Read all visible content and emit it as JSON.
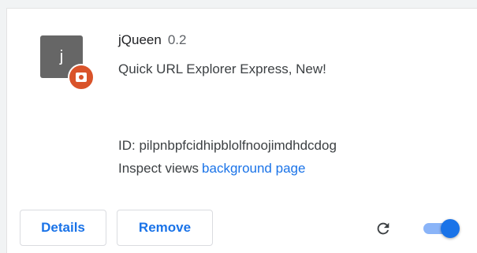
{
  "extension": {
    "icon_letter": "j",
    "icon": "extension-letter-icon",
    "badge_icon": "policy-badge-icon",
    "name": "jQueen",
    "version": "0.2",
    "description": "Quick URL Explorer Express, New!",
    "id_line": "ID: pilpnbpfcidhipblolfnoojimdhdcdog",
    "inspect_label": "Inspect views",
    "inspect_link": "background page"
  },
  "actions": {
    "details_label": "Details",
    "remove_label": "Remove",
    "reload_icon": "reload-icon",
    "toggle_enabled": true
  },
  "colors": {
    "accent": "#1a73e8",
    "icon_bg": "#666666",
    "badge_bg": "#d9532a"
  }
}
